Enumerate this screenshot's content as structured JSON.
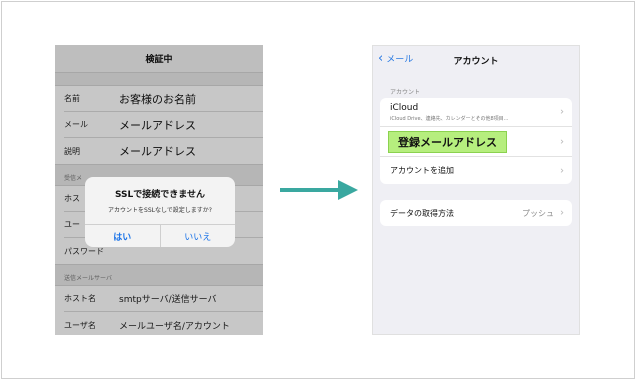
{
  "left_screen": {
    "nav_title": "検証中",
    "rows": [
      {
        "label": "名前",
        "value": "お客様のお名前"
      },
      {
        "label": "メール",
        "value": "メールアドレス"
      },
      {
        "label": "説明",
        "value": "メールアドレス"
      }
    ],
    "incoming_section": "受信メ",
    "incoming_rows": [
      {
        "label": "ホス",
        "value": ""
      },
      {
        "label": "ユー",
        "value": ""
      },
      {
        "label": "パスワード",
        "value": ""
      }
    ],
    "outgoing_section": "送信メールサーバ",
    "outgoing_rows": [
      {
        "label": "ホスト名",
        "value": "smtpサーバ/送信サーバ"
      },
      {
        "label": "ユーザ名",
        "value": "メールユーザ名/アカウント"
      }
    ],
    "alert": {
      "title": "SSLで接続できません",
      "message": "アカウントをSSLなしで設定しますか?",
      "yes_label": "はい",
      "no_label": "いいえ"
    }
  },
  "arrow_color": "#3aa8a0",
  "right_screen": {
    "back_label": "メール",
    "nav_title": "アカウント",
    "section_label": "アカウント",
    "icloud_title": "iCloud",
    "icloud_sub": "iCloud Drive、連絡先、カレンダーとその他8項目...",
    "highlight_label": "登録メールアドレス",
    "add_account_label": "アカウントを追加",
    "fetch_label": "データの取得方法",
    "fetch_value": "プッシュ"
  },
  "colors": {
    "link_blue": "#2a7ae2",
    "highlight_green": "#b6ee7e"
  }
}
